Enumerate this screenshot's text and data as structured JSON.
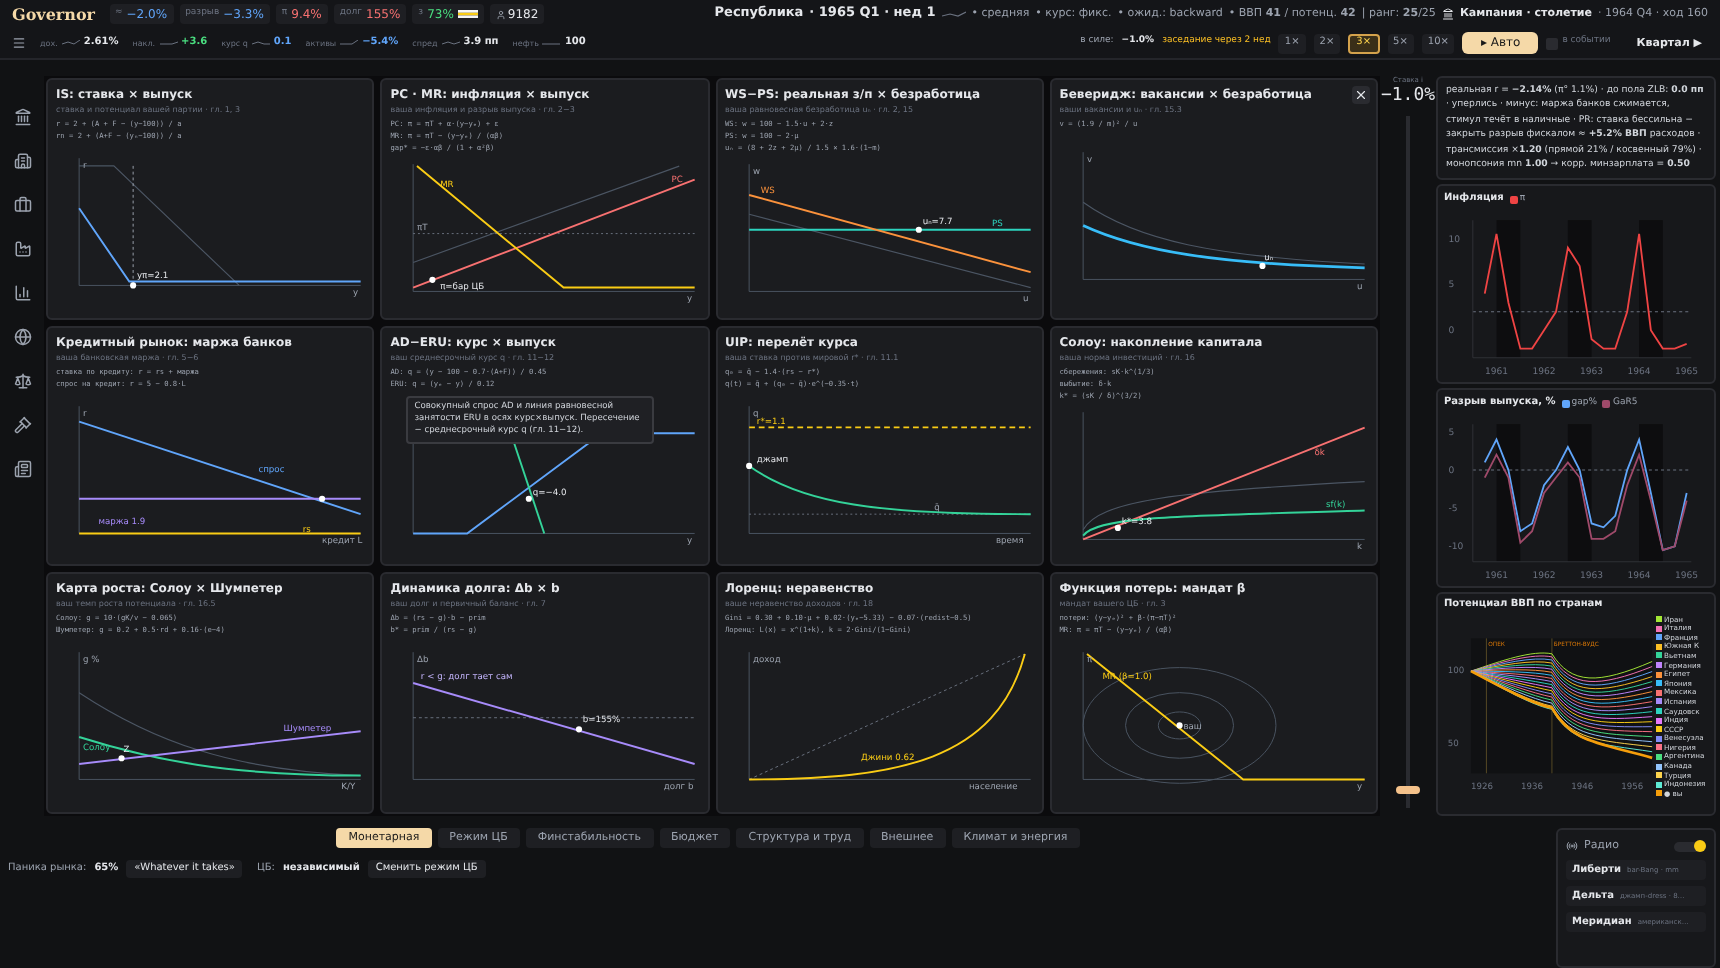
{
  "top_bar": {
    "logo": "Governor",
    "indicators": [
      {
        "label": "≈",
        "value": "−2.0%",
        "color": "#60a5fa",
        "flag": false
      },
      {
        "label": "разрыв",
        "value": "−3.3%",
        "color": "#60a5fa",
        "flag": false
      },
      {
        "label": "π",
        "value": "9.4%",
        "color": "#f87171",
        "flag": false
      },
      {
        "label": "долг",
        "value": "155%",
        "color": "#f87171",
        "flag": false
      },
      {
        "label": "з",
        "value": "73%",
        "color": "#4ade80",
        "flag": true
      }
    ],
    "population": "9182",
    "country": "Республика",
    "date": "· 1965 Q1 · нед 1",
    "tags": [
      "• средняя",
      "• курс: фикс.",
      "• ожид.: backward"
    ],
    "gdp": "• ВВП **41** / потенц. **42**",
    "rank": "| ранг: **25**/25",
    "campaign": "Кампания · столетие",
    "campaign_meta": "· 1964 Q4 · ход 160",
    "markets": [
      {
        "label": "дох.",
        "value": "2.61%",
        "color": "#e5e7eb"
      },
      {
        "label": "накл.",
        "value": "+3.6",
        "color": "#4ade80"
      },
      {
        "label": "курс q",
        "value": "0.1",
        "color": "#60a5fa"
      },
      {
        "label": "активы",
        "value": "−5.4%",
        "color": "#60a5fa"
      },
      {
        "label": "спред",
        "value": "3.9 пп",
        "color": "#e5e7eb"
      },
      {
        "label": "нефть",
        "value": "100",
        "color": "#e5e7eb"
      }
    ],
    "in_force_label": "в силе:",
    "in_force_value": "−1.0%",
    "meeting": "заседание через 2 нед",
    "speeds": [
      {
        "label": "1×",
        "selected": false
      },
      {
        "label": "2×",
        "selected": false
      },
      {
        "label": "3×",
        "selected": true
      },
      {
        "label": "5×",
        "selected": false
      },
      {
        "label": "10×",
        "selected": false
      }
    ],
    "auto_button": "▸ Авто",
    "in_event": {
      "label": "в событии",
      "checked": false
    },
    "quarter_button": "Квартал ▶"
  },
  "panels": [
    {
      "title": "IS: ставка × выпуск",
      "subtitle": "ставка и потенциал вашей партии · гл. 1, 3",
      "formulas": [
        "r = 2 + (A + F − (y−100)) / a",
        "rn = 2 + (A+F − (yₙ−100)) / a"
      ],
      "labels": [
        "r",
        "yπ=2.1",
        "y"
      ]
    },
    {
      "title": "PC · MR: инфляция × выпуск",
      "subtitle": "ваша инфляция и разрыв выпуска · гл. 2−3",
      "formulas": [
        "PC: π = πT + α·(y−yₑ) + ε",
        "MR: π = πT − (y−yₑ) / (αβ)",
        "gap* = −ε·αβ / (1 + α²β)"
      ],
      "labels": [
        "MR",
        "PC",
        "πT",
        "π=бар ЦБ",
        "y"
      ]
    },
    {
      "title": "WS−PS: реальная з/п × безработица",
      "subtitle": "ваша равновесная безработица uₙ · гл. 2, 15",
      "formulas": [
        "WS: w = 100 − 1.5·u + 2·z",
        "PS: w = 100 − 2·μ",
        "uₙ = (8 + 2z + 2μ) / 1.5 × 1.6·(1−m)"
      ],
      "labels": [
        "w",
        "WS",
        "uₙ=7.7",
        "PS",
        "u"
      ]
    },
    {
      "title": "Беверидж: вакансии × безработица",
      "subtitle": "ваши вакансии и uₙ · гл. 15.3",
      "formulas": [
        "v = (1.9 / m)² / u"
      ],
      "labels": [
        "v",
        "uₙ",
        "u"
      ],
      "closable": true
    },
    {
      "title": "Кредитный рынок: маржа банков",
      "subtitle": "ваша банковская маржа · гл. 5−6",
      "formulas": [
        "ставка по кредиту: r = rs + маржа",
        "спрос на кредит: r = 5 − 0.8·L"
      ],
      "labels": [
        "r",
        "спрос",
        "маржа 1.9",
        "rs",
        "кредит L"
      ]
    },
    {
      "title": "AD−ERU: курс × выпуск",
      "subtitle": "ваш среднесрочный курс q · гл. 11−12",
      "formulas": [
        "AD: q = (y − 100 − 0.7·(A+F)) / 0.45",
        "ERU: q = (yₑ − y) / 0.12"
      ],
      "labels": [
        "q=−4.0",
        "y"
      ],
      "tooltip": "Совокупный спрос AD и линия равновесной занятости ERU в осях курс×выпуск. Пересечение − среднесрочный курс q (гл. 11−12)."
    },
    {
      "title": "UIP: перелёт курса",
      "subtitle": "ваша ставка против мировой r* · гл. 11.1",
      "formulas": [
        "q₀ = q̄ − 1.4·(rs − r*)",
        "q(t) = q̄ + (q₀ − q̄)·e^(−0.35·t)"
      ],
      "labels": [
        "q",
        "r*=1.1",
        "джамп",
        "q̄",
        "время"
      ]
    },
    {
      "title": "Солоу: накопление капитала",
      "subtitle": "ваша норма инвестиций · гл. 16",
      "formulas": [
        "сбережения: sK·k^(1/3)",
        "выбытие: δ·k",
        "k* = (sK / δ)^(3/2)"
      ],
      "labels": [
        "δk",
        "k*=3.8",
        "sf(k)",
        "k"
      ]
    },
    {
      "title": "Карта роста: Солоу × Шумпетер",
      "subtitle": "ваш темп роста потенциала · гл. 16.5",
      "formulas": [
        "Солоу: g = 10·(gK/v − 0.065)",
        "Шумпетер: g = 0.2 + 0.5·rd + 0.16·(e−4)"
      ],
      "labels": [
        "g %",
        "Солоу",
        "Z",
        "Шумпетер",
        "K/Y"
      ]
    },
    {
      "title": "Динамика долга: Δb × b",
      "subtitle": "ваш долг и первичный баланс · гл. 7",
      "formulas": [
        "Δb = (rs − g)·b − prim",
        "b* = prim / (rs − g)"
      ],
      "labels": [
        "Δb",
        "r < g: долг тает сам",
        "b=155%",
        "долг b"
      ]
    },
    {
      "title": "Лоренц: неравенство",
      "subtitle": "ваше неравенство доходов · гл. 18",
      "formulas": [
        "Gini = 0.30 + 0.10·μ + 0.02·(yₑ−5.33) − 0.07·(redist−0.5)",
        "Лоренц: L(x) = x^(1+k), k = 2·Gini/(1−Gini)"
      ],
      "labels": [
        "доход",
        "Джини 0.62",
        "население"
      ]
    },
    {
      "title": "Функция потерь: мандат β",
      "subtitle": "мандат вашего ЦБ · гл. 3",
      "formulas": [
        "потери: (y−yₑ)² + β·(π−πT)²",
        "MR: π = πT − (y−yₑ) / (αβ)"
      ],
      "labels": [
        "π",
        "MR (β=1.0)",
        "ваш",
        "y"
      ]
    }
  ],
  "rate_slider": {
    "label": "Ставка i",
    "value": "−1.0%",
    "level": 0.02
  },
  "info": "реальная r = **−2.14%** (π° 1.1%) · до пола ZLB: **0.0 пп** · уперлись · минус: маржа банков сжимается, стимул течёт в наличные · PR: ставка бессильна − закрыть разрыв фискалом ≈ **+5.2% ВВП** расходов · трансмиссия ×**1.20** (прямой 21% / косвенный 79%) · монопсония mn **1.00** → корр. минзарплата = **0.50**",
  "inflation_chart": {
    "chart_data": {
      "type": "line",
      "title": "Инфляция",
      "x": [
        1960.75,
        1961,
        1961.25,
        1961.5,
        1961.75,
        1962,
        1962.25,
        1962.5,
        1962.75,
        1963,
        1963.25,
        1963.5,
        1963.75,
        1964,
        1964.25,
        1964.5,
        1964.75,
        1965
      ],
      "series": [
        {
          "name": "π",
          "color": "#ef4444",
          "values": [
            4,
            10.5,
            3,
            -2,
            -2,
            0,
            2,
            9,
            7,
            -1,
            -2,
            -2,
            2,
            10.5,
            0,
            -2,
            -2,
            -1.5
          ]
        }
      ],
      "xlim": [
        1960.5,
        1965.1
      ],
      "ylim": [
        -3,
        12
      ],
      "xticks": [
        1961,
        1962,
        1963,
        1964,
        1965
      ],
      "yticks": [
        10,
        5,
        0
      ]
    }
  },
  "gap_chart": {
    "chart_data": {
      "type": "line",
      "title": "Разрыв выпуска, %",
      "x": [
        1960.75,
        1961,
        1961.25,
        1961.5,
        1961.75,
        1962,
        1962.25,
        1962.5,
        1962.75,
        1963,
        1963.25,
        1963.5,
        1963.75,
        1964,
        1964.25,
        1964.5,
        1964.75,
        1965
      ],
      "series": [
        {
          "name": "gap%",
          "color": "#60a5fa",
          "values": [
            1,
            4,
            0,
            -8,
            -7,
            -2,
            0,
            3,
            0,
            -7,
            -7.5,
            -6,
            0,
            4,
            -3,
            -10.5,
            -10,
            -3
          ]
        },
        {
          "name": "GaR5",
          "color": "#9f4a6a",
          "values": [
            -1,
            2,
            -1,
            -9.5,
            -8,
            -3,
            -1,
            1,
            -1,
            -9,
            -9,
            -8,
            -2,
            2,
            -4,
            -10.5,
            -10,
            -4
          ]
        }
      ],
      "xlim": [
        1960.5,
        1965.1
      ],
      "ylim": [
        -12,
        6
      ],
      "xticks": [
        1961,
        1962,
        1963,
        1964,
        1965
      ],
      "yticks": [
        5,
        0,
        -5,
        -10
      ]
    }
  },
  "potential_chart": {
    "title": "Потенциал ВВП по странам",
    "events": [
      "ОПЕК",
      "БРЕТТОН-ВУДС"
    ],
    "xticks": [
      "1926",
      "1936",
      "1946",
      "1956"
    ],
    "yticks": [
      "100",
      "50"
    ],
    "legend": [
      {
        "name": "Иран",
        "color": "#a3e635"
      },
      {
        "name": "Италия",
        "color": "#f472b6"
      },
      {
        "name": "Франция",
        "color": "#60a5fa"
      },
      {
        "name": "Южная К",
        "color": "#fbbf24"
      },
      {
        "name": "Вьетнам",
        "color": "#34d399"
      },
      {
        "name": "Германия",
        "color": "#c084fc"
      },
      {
        "name": "Египет",
        "color": "#fb923c"
      },
      {
        "name": "Япония",
        "color": "#38bdf8"
      },
      {
        "name": "Мексика",
        "color": "#f87171"
      },
      {
        "name": "Испания",
        "color": "#a78bfa"
      },
      {
        "name": "Саудовск",
        "color": "#2dd4bf"
      },
      {
        "name": "Индия",
        "color": "#e879f9"
      },
      {
        "name": "СССР",
        "color": "#facc15"
      },
      {
        "name": "Венесуэла",
        "color": "#818cf8"
      },
      {
        "name": "Нигерия",
        "color": "#fb7185"
      },
      {
        "name": "Аргентина",
        "color": "#4ade80"
      },
      {
        "name": "Канада",
        "color": "#93c5fd"
      },
      {
        "name": "Турция",
        "color": "#fcd34d"
      },
      {
        "name": "Индонезия",
        "color": "#5eead4"
      },
      {
        "name": "● вы",
        "color": "#f59e0b"
      }
    ]
  },
  "tabs": [
    {
      "label": "Монетарная",
      "selected": true
    },
    {
      "label": "Режим ЦБ",
      "selected": false
    },
    {
      "label": "Финстабильность",
      "selected": false
    },
    {
      "label": "Бюджет",
      "selected": false
    },
    {
      "label": "Структура и труд",
      "selected": false
    },
    {
      "label": "Внешнее",
      "selected": false
    },
    {
      "label": "Климат и энергия",
      "selected": false
    }
  ],
  "status": {
    "panic_label": "Паника рынка:",
    "panic_value": "65%",
    "whatever_button": "«Whatever it takes»",
    "cb_label": "ЦБ:",
    "cb_value": "независимый",
    "change_button": "Сменить режим ЦБ"
  },
  "radio": {
    "title": "Радио",
    "on": true,
    "stations": [
      {
        "name": "Либерти",
        "track": "bar-Bang · mm"
      },
      {
        "name": "Дельта",
        "track": "джамп-dress · 8…"
      },
      {
        "name": "Меридиан",
        "track": "американск…"
      }
    ]
  }
}
